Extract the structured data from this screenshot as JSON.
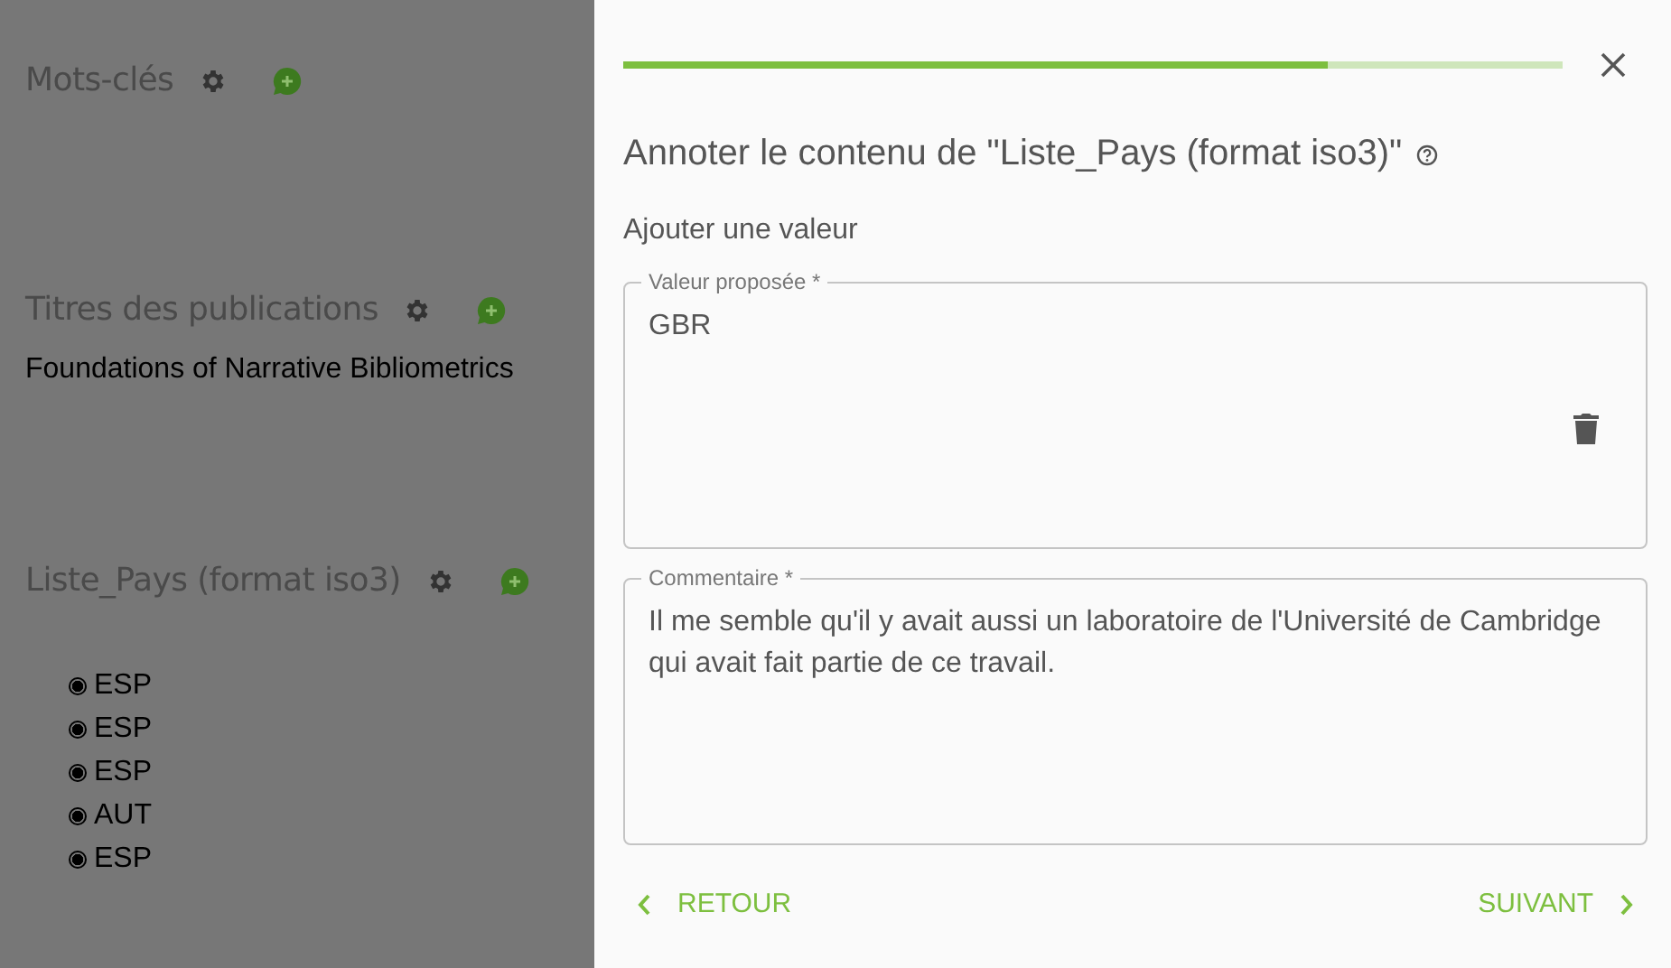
{
  "background_page": {
    "sections": [
      {
        "title": "Mots-clés"
      },
      {
        "title": "Titres des publications",
        "items": [
          "Foundations of Narrative Bibliometrics"
        ]
      },
      {
        "title": "Liste_Pays (format iso3)",
        "entries": [
          {
            "label": "ESP",
            "selected": true
          },
          {
            "label": "ESP",
            "selected": true
          },
          {
            "label": "ESP",
            "selected": true
          },
          {
            "label": "AUT",
            "selected": true
          },
          {
            "label": "ESP",
            "selected": true
          }
        ]
      }
    ]
  },
  "drawer": {
    "progress": {
      "level": 0.75
    },
    "title": "Annoter le contenu de \"Liste_Pays (format iso3)\"",
    "subtitle": "Ajouter une valeur",
    "fields": [
      {
        "label": "Valeur proposée *",
        "value": "GBR",
        "deletable": true
      },
      {
        "label": "Commentaire *",
        "value": "Il me semble qu'il y avait aussi un laboratoire de l'Université de Cambridge qui avait fait partie de ce travail.",
        "deletable": false
      }
    ],
    "back_button": "RETOUR",
    "next_button": "SUIVANT"
  }
}
